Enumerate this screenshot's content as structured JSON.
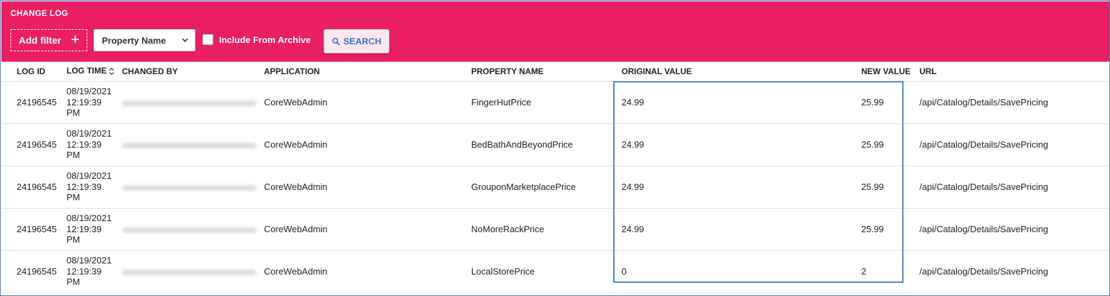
{
  "header": {
    "title": "CHANGE LOG",
    "add_filter_label": "Add filter",
    "add_filter_icon": "plus-icon",
    "property_select_value": "Property Name",
    "archive_label": "Include From Archive",
    "search_label": "SEARCH",
    "accent_color": "#e91e63"
  },
  "table": {
    "columns": [
      "LOG ID",
      "LOG TIME",
      "CHANGED BY",
      "APPLICATION",
      "PROPERTY NAME",
      "ORIGINAL VALUE",
      "NEW VALUE",
      "URL"
    ],
    "rows": [
      {
        "log_id": "24196545",
        "date": "08/19/2021",
        "time": "12:19:39",
        "ampm": "PM",
        "application": "CoreWebAdmin",
        "property": "FingerHutPrice",
        "original": "24.99",
        "new": "25.99",
        "url": "/api/Catalog/Details/SavePricing"
      },
      {
        "log_id": "24196545",
        "date": "08/19/2021",
        "time": "12:19:39",
        "ampm": "PM",
        "application": "CoreWebAdmin",
        "property": "BedBathAndBeyondPrice",
        "original": "24.99",
        "new": "25.99",
        "url": "/api/Catalog/Details/SavePricing"
      },
      {
        "log_id": "24196545",
        "date": "08/19/2021",
        "time": "12:19:39",
        "ampm": "PM",
        "application": "CoreWebAdmin",
        "property": "GrouponMarketplacePrice",
        "original": "24.99",
        "new": "25.99",
        "url": "/api/Catalog/Details/SavePricing"
      },
      {
        "log_id": "24196545",
        "date": "08/19/2021",
        "time": "12:19:39",
        "ampm": "PM",
        "application": "CoreWebAdmin",
        "property": "NoMoreRackPrice",
        "original": "24.99",
        "new": "25.99",
        "url": "/api/Catalog/Details/SavePricing"
      },
      {
        "log_id": "24196545",
        "date": "08/19/2021",
        "time": "12:19:39",
        "ampm": "PM",
        "application": "CoreWebAdmin",
        "property": "LocalStorePrice",
        "original": "0",
        "new": "2",
        "url": "/api/Catalog/Details/SavePricing"
      }
    ]
  }
}
